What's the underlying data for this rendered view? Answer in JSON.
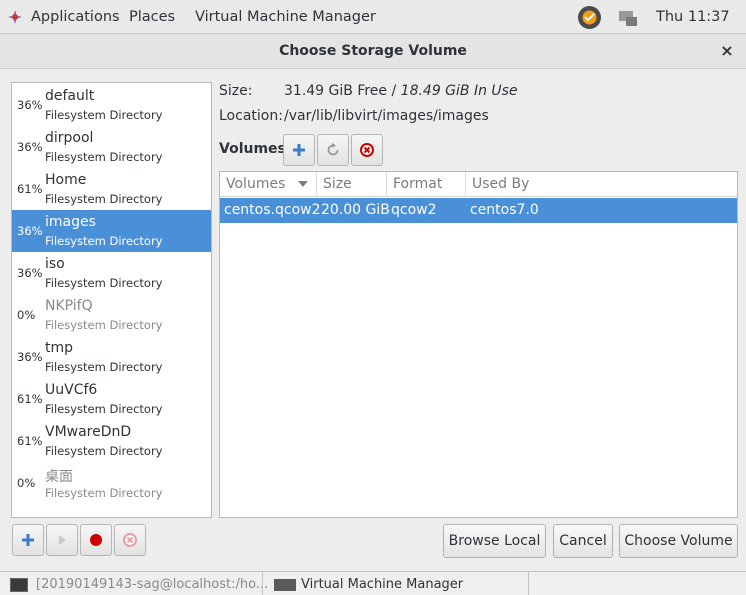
{
  "topbar": {
    "applications": "Applications",
    "places": "Places",
    "app_menu": "Virtual Machine Manager",
    "clock": "Thu 11:37"
  },
  "dialog": {
    "title": "Choose Storage Volume",
    "close": "×"
  },
  "pools": [
    {
      "pct": "36%",
      "name": "default",
      "type": "Filesystem Directory",
      "active": true
    },
    {
      "pct": "36%",
      "name": "dirpool",
      "type": "Filesystem Directory",
      "active": true
    },
    {
      "pct": "61%",
      "name": "Home",
      "type": "Filesystem Directory",
      "active": true
    },
    {
      "pct": "36%",
      "name": "images",
      "type": "Filesystem Directory",
      "active": true,
      "selected": true
    },
    {
      "pct": "36%",
      "name": "iso",
      "type": "Filesystem Directory",
      "active": true
    },
    {
      "pct": "0%",
      "name": "NKPifQ",
      "type": "Filesystem Directory",
      "active": false
    },
    {
      "pct": "36%",
      "name": "tmp",
      "type": "Filesystem Directory",
      "active": true
    },
    {
      "pct": "61%",
      "name": "UuVCf6",
      "type": "Filesystem Directory",
      "active": true
    },
    {
      "pct": "61%",
      "name": "VMwareDnD",
      "type": "Filesystem Directory",
      "active": true
    },
    {
      "pct": "0%",
      "name": "桌面",
      "type": "Filesystem Directory",
      "active": false
    }
  ],
  "info": {
    "size_label": "Size:",
    "size_free": "31.49 GiB Free",
    "size_sep": " / ",
    "size_used": "18.49 GiB In Use",
    "location_label": "Location:",
    "location_value": "/var/lib/libvirt/images/images",
    "volumes_label": "Volumes"
  },
  "table": {
    "headers": [
      "Volumes",
      "Size",
      "Format",
      "Used By"
    ],
    "rows": [
      {
        "volume": "centos.qcow2",
        "size": "20.00 GiB",
        "format": "qcow2",
        "used_by": "centos7.0"
      }
    ]
  },
  "buttons": {
    "browse_local": "Browse Local",
    "cancel": "Cancel",
    "choose_volume": "Choose Volume"
  },
  "taskbar": {
    "terminal": "[20190149143-sag@localhost:/ho...",
    "vmm": "Virtual Machine Manager"
  },
  "colors": {
    "selection": "#4a90d9",
    "add": "#3c7bc7",
    "delete": "#cc0000",
    "stop": "#cc0000"
  }
}
